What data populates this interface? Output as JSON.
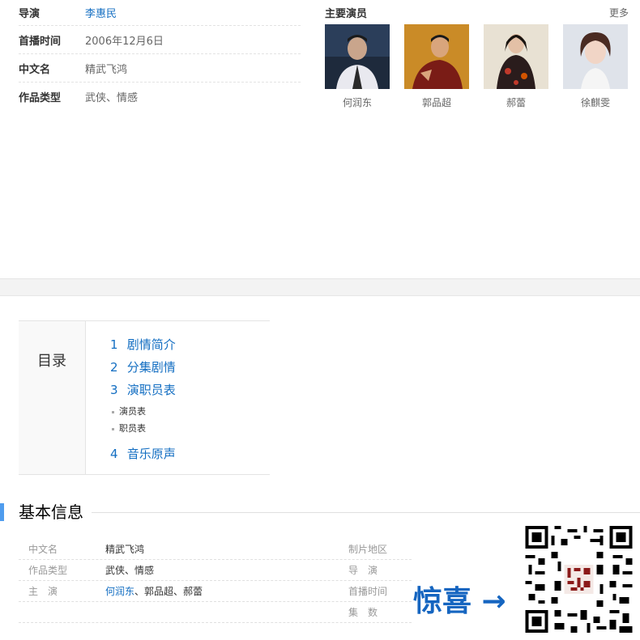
{
  "info": [
    {
      "label": "导演",
      "value": "李惠民",
      "link": true
    },
    {
      "label": "首播时间",
      "value": "2006年12月6日",
      "link": false
    },
    {
      "label": "中文名",
      "value": "精武飞鸿",
      "link": false
    },
    {
      "label": "作品类型",
      "value": "武侠、情感",
      "link": false
    }
  ],
  "actors": {
    "title": "主要演员",
    "more": "更多",
    "items": [
      {
        "name": "何润东"
      },
      {
        "name": "郭品超"
      },
      {
        "name": "郝蕾"
      },
      {
        "name": "徐麒雯"
      }
    ]
  },
  "toc": {
    "title": "目录",
    "items": [
      {
        "num": "1",
        "label": "剧情简介"
      },
      {
        "num": "2",
        "label": "分集剧情"
      },
      {
        "num": "3",
        "label": "演职员表"
      },
      {
        "num": "4",
        "label": "音乐原声"
      }
    ],
    "subs": [
      "演员表",
      "职员表"
    ]
  },
  "basic": {
    "title": "基本信息",
    "rows": [
      {
        "label": "中文名",
        "value": "精武飞鸿",
        "label2": "制片地区"
      },
      {
        "label": "作品类型",
        "value": "武侠、情感",
        "label2": "导　演"
      },
      {
        "label": "主　演",
        "value_link": "何润东",
        "value_rest": "、郭品超、郝蕾",
        "label2": "首播时间"
      },
      {
        "label": "",
        "value": "",
        "label2": "集　数"
      }
    ]
  },
  "overlay": {
    "text": "惊喜 →"
  },
  "colors": {
    "link": "#136ec2",
    "accent_bar": "#4f9cee",
    "overlay_text": "#1565c0"
  }
}
